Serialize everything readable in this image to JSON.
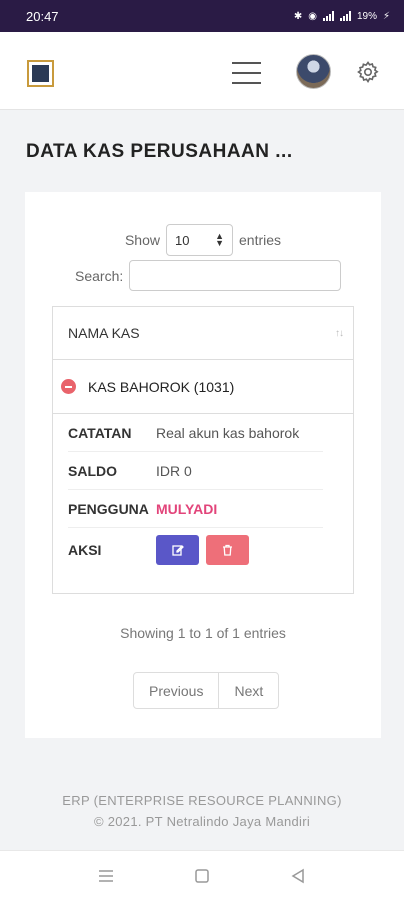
{
  "status_bar": {
    "time": "20:47",
    "battery": "19%",
    "icons": [
      "bluetooth-icon",
      "wifi-icon",
      "signal-icon",
      "signal-icon",
      "battery-icon"
    ]
  },
  "app_bar": {
    "icons": [
      "company-logo",
      "hamburger-menu-icon",
      "user-avatar",
      "gear-icon"
    ]
  },
  "page": {
    "title": "DATA KAS PERUSAHAAN ..."
  },
  "table_controls": {
    "show_label": "Show",
    "entries_value": "10",
    "entries_label": "entries",
    "search_label": "Search:",
    "search_value": ""
  },
  "table": {
    "column_header": "NAMA KAS",
    "rows": [
      {
        "name": "KAS BAHOROK (1031)",
        "details": [
          {
            "label": "CATATAN",
            "value": "Real akun kas bahorok"
          },
          {
            "label": "SALDO",
            "value": "IDR 0"
          },
          {
            "label": "PENGGUNA",
            "value": "MULYADI"
          },
          {
            "label": "AKSI",
            "value": ""
          }
        ]
      }
    ]
  },
  "pagination": {
    "info": "Showing 1 to 1 of 1 entries",
    "previous": "Previous",
    "next": "Next"
  },
  "footer": {
    "line1": "ERP (ENTERPRISE RESOURCE PLANNING)",
    "line2": "© 2021. PT Netralindo Jaya Mandiri"
  },
  "colors": {
    "status_bar": "#2a1b45",
    "edit_button": "#5a57c8",
    "delete_button": "#ee6f79",
    "user_highlight": "#e2447a",
    "collapse_dot": "#e9636b"
  }
}
